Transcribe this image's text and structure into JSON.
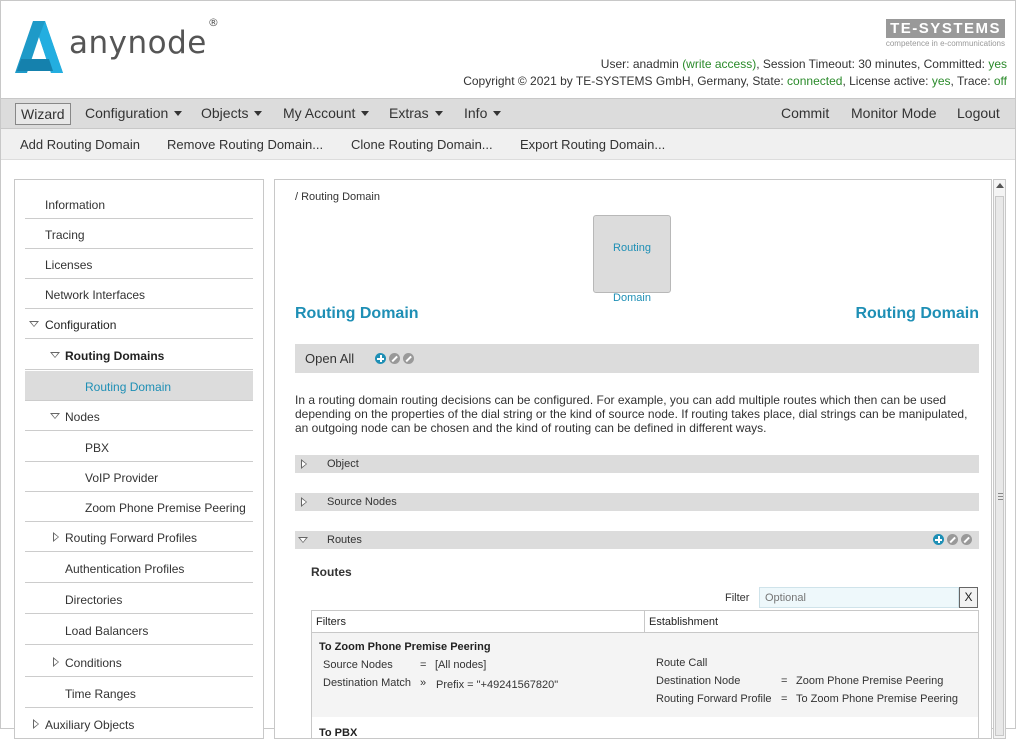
{
  "header": {
    "app_name": "anynode",
    "reg_mark": "®",
    "brand": "TE-SYSTEMS",
    "brand_tagline": "competence in e-communications",
    "user_label": "User: ",
    "user_name": "anadmin",
    "user_access": "(write access)",
    "session_timeout": ", Session Timeout: 30 minutes, Committed: ",
    "committed": "yes",
    "copyright": "Copyright © 2021 by TE-SYSTEMS GmbH, Germany, State: ",
    "state": "connected",
    "license_label": ", License active: ",
    "license": "yes",
    "trace_label": ", Trace: ",
    "trace": "off"
  },
  "menu": {
    "wizard": "Wizard",
    "configuration": "Configuration",
    "objects": "Objects",
    "my_account": "My Account",
    "extras": "Extras",
    "info": "Info",
    "commit": "Commit",
    "monitor_mode": "Monitor Mode",
    "logout": "Logout"
  },
  "actions": {
    "add": "Add Routing Domain",
    "remove": "Remove Routing Domain...",
    "clone": "Clone Routing Domain...",
    "export": "Export Routing Domain..."
  },
  "sidebar": {
    "information": "Information",
    "tracing": "Tracing",
    "licenses": "Licenses",
    "network_interfaces": "Network Interfaces",
    "configuration": "Configuration",
    "routing_domains": "Routing Domains",
    "routing_domain": "Routing Domain",
    "nodes": "Nodes",
    "pbx": "PBX",
    "voip_provider": "VoIP Provider",
    "zoom_peering": "Zoom Phone Premise Peering",
    "routing_forward_profiles": "Routing Forward Profiles",
    "authentication_profiles": "Authentication Profiles",
    "directories": "Directories",
    "load_balancers": "Load Balancers",
    "conditions": "Conditions",
    "time_ranges": "Time Ranges",
    "auxiliary_objects": "Auxiliary Objects"
  },
  "main": {
    "breadcrumb": "/ Routing Domain",
    "node_line1": "Routing",
    "node_line2": "Domain",
    "title_left": "Routing Domain",
    "title_right": "Routing Domain",
    "open_all": "Open All",
    "description": "In a routing domain routing decisions can be configured. For example, you can add multiple routes which then can be used depending on the properties of the dial string or the kind of source node. If routing takes place, dial strings can be manipulated, an outgoing node can be chosen and the kind of routing can be defined in different ways.",
    "section_object": "Object",
    "section_source_nodes": "Source Nodes",
    "section_routes": "Routes",
    "routes_title": "Routes",
    "filter_label": "Filter",
    "filter_placeholder": "Optional",
    "filter_clear": "X",
    "col_filters": "Filters",
    "col_establishment": "Establishment",
    "route1": {
      "name": "To Zoom Phone Premise Peering",
      "source_nodes_label": "Source Nodes",
      "source_nodes_op": "=",
      "source_nodes_value": "[All nodes]",
      "dest_match_label": "Destination Match",
      "dest_match_op": "»",
      "dest_match_value": "Prefix  =  \"+49241567820\"",
      "est_type": "Route Call",
      "dest_node_label": "Destination Node",
      "dest_node_op": "=",
      "dest_node_value": "Zoom Phone Premise Peering",
      "rfp_label": "Routing Forward Profile",
      "rfp_op": "=",
      "rfp_value": "To Zoom Phone Premise Peering"
    },
    "route2_name": "To PBX"
  }
}
